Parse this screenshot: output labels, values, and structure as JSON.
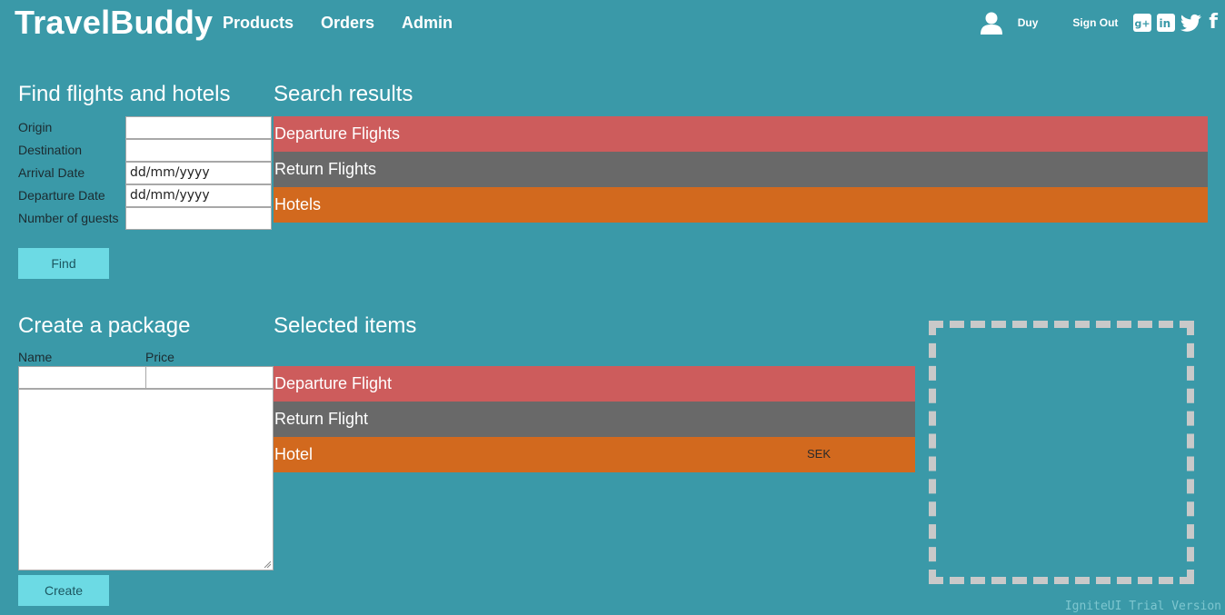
{
  "app": {
    "brand": "TravelBuddy",
    "nav": [
      "Products",
      "Orders",
      "Admin"
    ],
    "user_name": "Duy",
    "sign_out": "Sign Out",
    "social_icons": [
      "google-plus-icon",
      "linkedin-icon",
      "twitter-icon",
      "facebook-icon"
    ]
  },
  "search_form": {
    "title": "Find flights and hotels",
    "fields": [
      {
        "label": "Origin",
        "value": ""
      },
      {
        "label": "Destination",
        "value": ""
      },
      {
        "label": "Arrival Date",
        "value": "dd/mm/yyyy"
      },
      {
        "label": "Departure Date",
        "value": "dd/mm/yyyy"
      },
      {
        "label": "Number of guests",
        "value": ""
      }
    ],
    "button": "Find"
  },
  "search_results": {
    "title": "Search results",
    "sections": [
      "Departure Flights",
      "Return Flights",
      "Hotels"
    ]
  },
  "package": {
    "title": "Create a package",
    "name_label": "Name",
    "price_label": "Price",
    "button": "Create"
  },
  "selected_items": {
    "title": "Selected items",
    "rows": [
      "Departure Flight",
      "Return Flight",
      "Hotel"
    ],
    "currency": "SEK"
  },
  "footer": {
    "trial": "IgniteUI Trial Version"
  },
  "colors": {
    "background": "#3a99a8",
    "departure": "#cd5c5c",
    "return": "#696969",
    "hotel": "#d2691e",
    "button": "#6cdae4",
    "dropzone_border": "#c9c9c9"
  }
}
